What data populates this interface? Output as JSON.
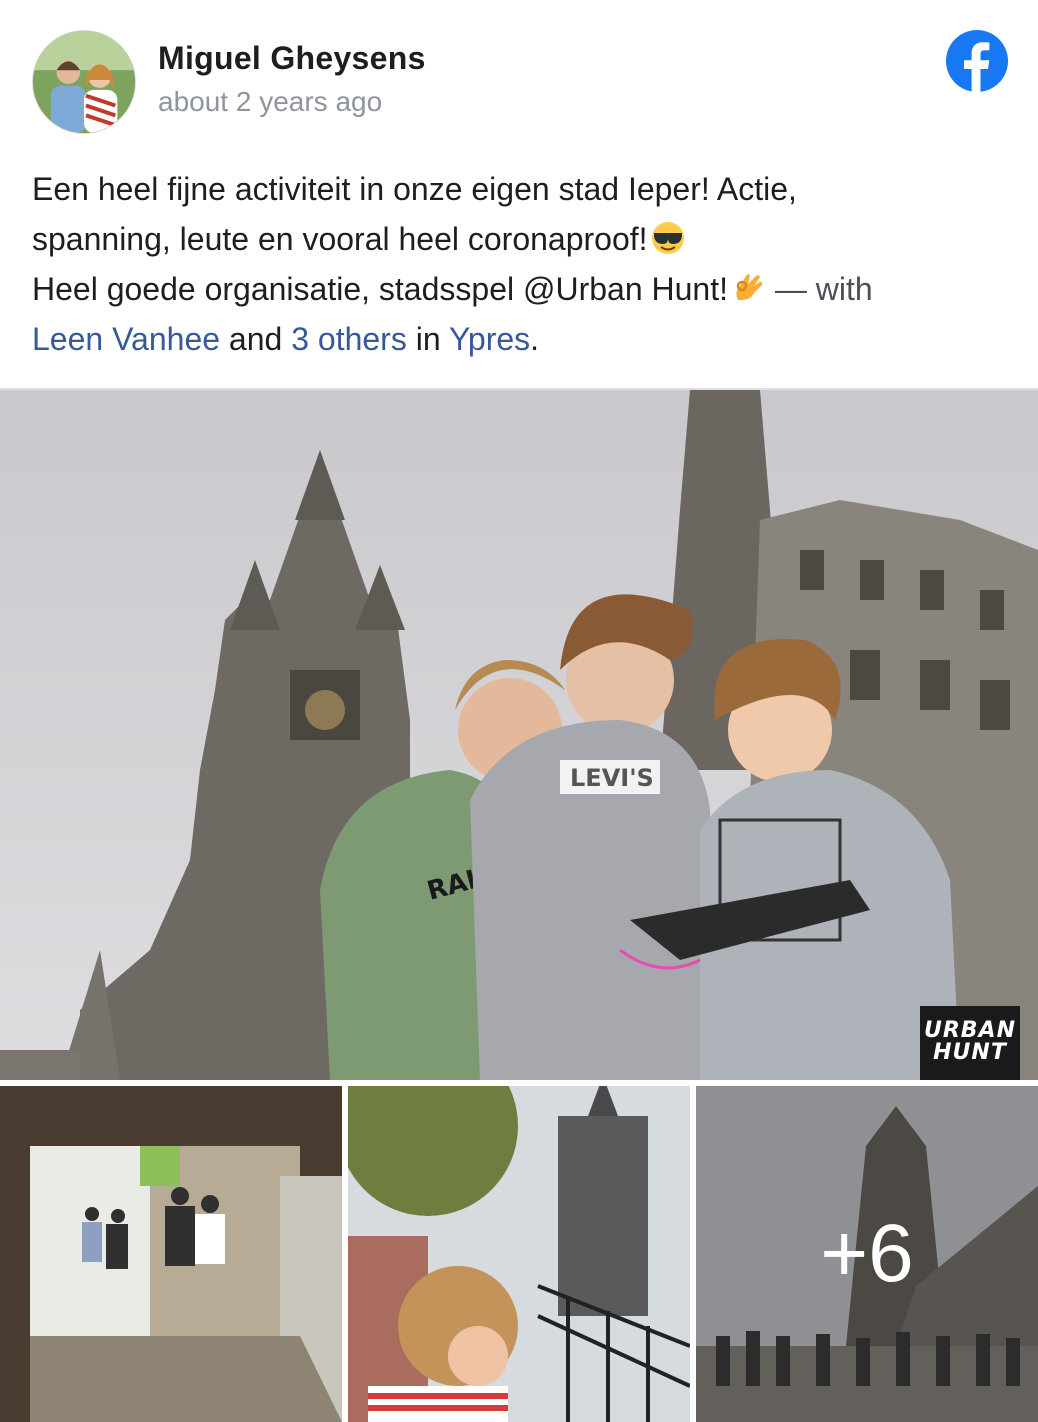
{
  "post": {
    "author": "Miguel Gheysens",
    "timestamp": "about 2 years ago",
    "text": {
      "line1": "Een heel fijne activiteit in onze eigen stad Ieper! Actie,",
      "line2": "spanning, leute en vooral heel coronaproof!",
      "line3": "Heel goede organisatie, stadsspel @Urban Hunt!",
      "with": "— with",
      "tag_person": "Leen Vanhee",
      "and": "and",
      "tag_others": "3 others",
      "in": "in",
      "tag_place": "Ypres",
      "period": "."
    },
    "emojis": [
      "sunglasses-emoji",
      "ok-hand-emoji"
    ]
  },
  "photos": {
    "main_watermark_line1": "URBAN",
    "main_watermark_line2": "HUNT",
    "more_count": "+6"
  },
  "colors": {
    "facebook_blue": "#1877f2",
    "link": "#385898",
    "timestamp": "#90949c"
  },
  "icons": [
    "facebook-logo-icon"
  ]
}
